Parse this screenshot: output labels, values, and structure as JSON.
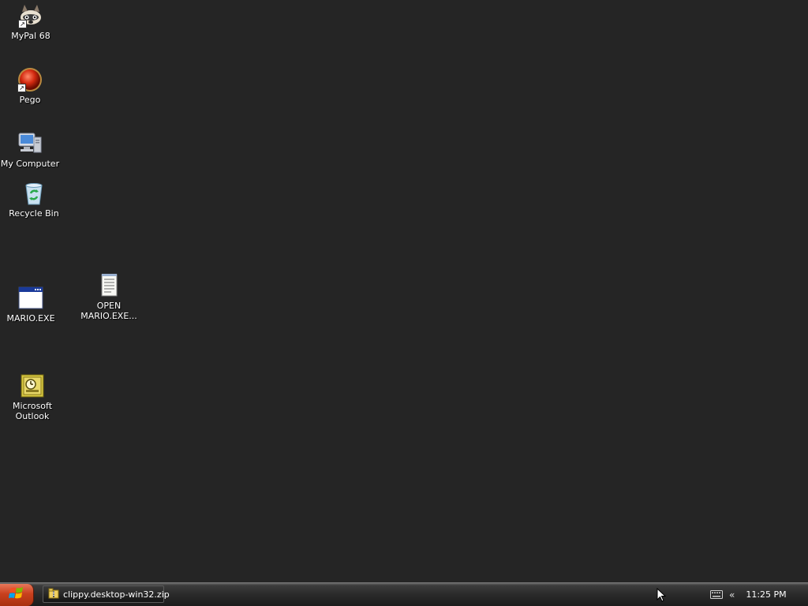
{
  "desktop": {
    "icons": [
      {
        "label": "MyPal 68",
        "icon": "raccoon-icon"
      },
      {
        "label": "Pego",
        "icon": "red-orb-icon"
      },
      {
        "label": "My Computer",
        "icon": "computer-icon"
      },
      {
        "label": "Recycle Bin",
        "icon": "recycle-bin-icon"
      },
      {
        "label": "MARIO.EXE",
        "icon": "application-window-icon"
      },
      {
        "label": "OPEN\nMARIO.EXE...",
        "icon": "text-document-icon"
      },
      {
        "label": "Microsoft\nOutlook",
        "icon": "outlook-clock-icon"
      }
    ]
  },
  "taskbar": {
    "start_icon": "windows-flag-icon",
    "task_label": "clippy.desktop-win32.zip",
    "task_icon": "zip-folder-icon",
    "tray_keyboard_icon": "keyboard-icon",
    "tray_expand": "«",
    "clock": "11:25 PM"
  },
  "colors": {
    "desktop_background": "#252525",
    "start_button": "#c8401e"
  }
}
